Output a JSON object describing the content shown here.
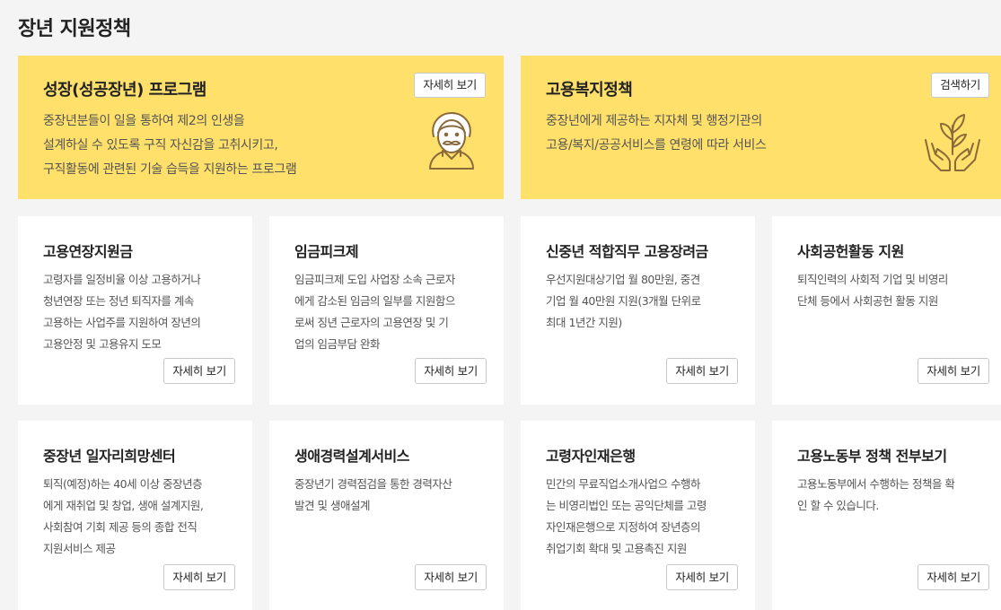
{
  "page": {
    "title": "장년 지원정책"
  },
  "heroes": [
    {
      "title": "성장(성공장년) 프로그램",
      "button": "자세히 보기",
      "icon": "elderly-person-icon",
      "lines": [
        "중장년분들이 일을 통하여 제2의 인생을",
        "설계하실 수 있도록 구직 자신감을 고취시키고,",
        "구직활동에 관련된 기술 습득을 지원하는 프로그램"
      ]
    },
    {
      "title": "고용복지정책",
      "button": "검색하기",
      "icon": "hands-plant-icon",
      "lines": [
        "중장년에게 제공하는 지자체 및 행정기관의",
        "고용/복지/공공서비스를 연령에 따라 서비스"
      ]
    }
  ],
  "cards": [
    {
      "title": "고용연장지원금",
      "button": "자세히 보기",
      "lines": [
        "고령자를 일정비율 이상 고용하거나",
        "청년연장 또는 정년 퇴직자를 계속",
        "고용하는 사업주를 지원하여 장년의",
        "고용안정 및 고용유지 도모"
      ]
    },
    {
      "title": "임금피크제",
      "button": "자세히 보기",
      "lines": [
        "임금피크제 도입 사업장 소속 근로자",
        "에게 감소된 임금의 일부를 지원함으",
        "로써 징년 근로자의 고용연장 및 기",
        "업의 임금부담 완화"
      ]
    },
    {
      "title": "신중년 적합직무 고용장려금",
      "button": "자세히 보기",
      "lines": [
        "우선지원대상기업 월 80만원, 중견",
        "기업 월 40만원 지원(3개월 단위로",
        "최대 1년간 지원)"
      ]
    },
    {
      "title": "사회공헌활동 지원",
      "button": "자세히 보기",
      "lines": [
        "퇴직인력의 사회적 기업 및 비영리",
        "단체 등에서 사회공헌 활동 지원"
      ]
    },
    {
      "title": "중장년 일자리희망센터",
      "button": "자세히 보기",
      "lines": [
        "퇴직(예정)하는 40세 이상 중장년층",
        "에게 재취업 및 창업, 생애 설계지원,",
        "사회참여 기회 제공 등의 종합 전직",
        "지원서비스 제공"
      ]
    },
    {
      "title": "생애경력설계서비스",
      "button": "자세히 보기",
      "lines": [
        "중장년기 경력점검을 통한 경력자산",
        "발견 및 생애설계"
      ]
    },
    {
      "title": "고령자인재은행",
      "button": "자세히 보기",
      "lines": [
        "민간의 무료직업소개사업으 수행하",
        "는 비영리법인 또는 공익단체를 고령",
        "자인재은행으로 지정하여 장년층의",
        "취업기회 확대 및 고용촉진 지원"
      ]
    },
    {
      "title": "고용노동부 정책 전부보기",
      "button": "자세히 보기",
      "lines": [
        "고용노동부에서 수행하는 정책을 확",
        "인 할 수 있습니다."
      ]
    }
  ],
  "colors": {
    "hero_bg": "#ffe06b",
    "page_bg": "#f4f4f4",
    "icon_stroke": "#8a6a3a"
  }
}
